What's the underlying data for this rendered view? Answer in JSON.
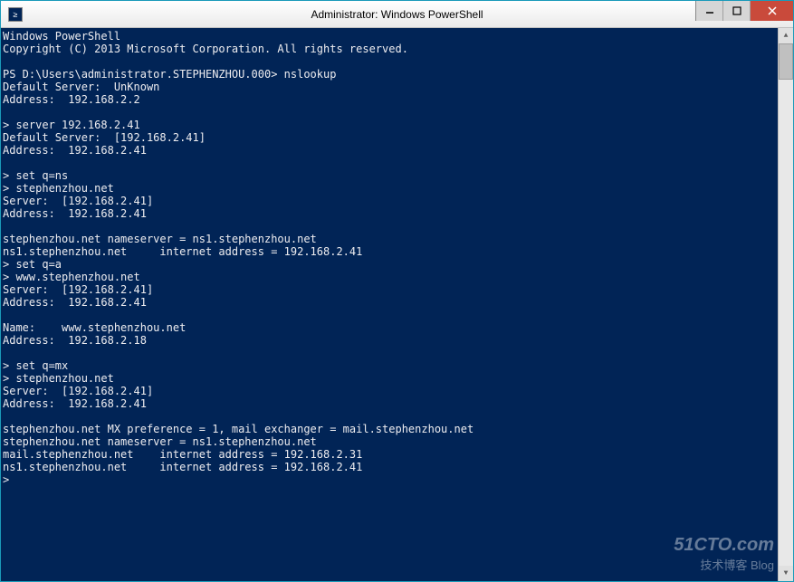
{
  "window": {
    "title": "Administrator: Windows PowerShell",
    "icon_glyph": "≥"
  },
  "terminal": {
    "lines": [
      "Windows PowerShell",
      "Copyright (C) 2013 Microsoft Corporation. All rights reserved.",
      "",
      "PS D:\\Users\\administrator.STEPHENZHOU.000> nslookup",
      "Default Server:  UnKnown",
      "Address:  192.168.2.2",
      "",
      "> server 192.168.2.41",
      "Default Server:  [192.168.2.41]",
      "Address:  192.168.2.41",
      "",
      "> set q=ns",
      "> stephenzhou.net",
      "Server:  [192.168.2.41]",
      "Address:  192.168.2.41",
      "",
      "stephenzhou.net nameserver = ns1.stephenzhou.net",
      "ns1.stephenzhou.net     internet address = 192.168.2.41",
      "> set q=a",
      "> www.stephenzhou.net",
      "Server:  [192.168.2.41]",
      "Address:  192.168.2.41",
      "",
      "Name:    www.stephenzhou.net",
      "Address:  192.168.2.18",
      "",
      "> set q=mx",
      "> stephenzhou.net",
      "Server:  [192.168.2.41]",
      "Address:  192.168.2.41",
      "",
      "stephenzhou.net MX preference = 1, mail exchanger = mail.stephenzhou.net",
      "stephenzhou.net nameserver = ns1.stephenzhou.net",
      "mail.stephenzhou.net    internet address = 192.168.2.31",
      "ns1.stephenzhou.net     internet address = 192.168.2.41",
      ">"
    ]
  },
  "watermark": {
    "line1": "51CTO.com",
    "line2": "技术博客        Blog"
  }
}
